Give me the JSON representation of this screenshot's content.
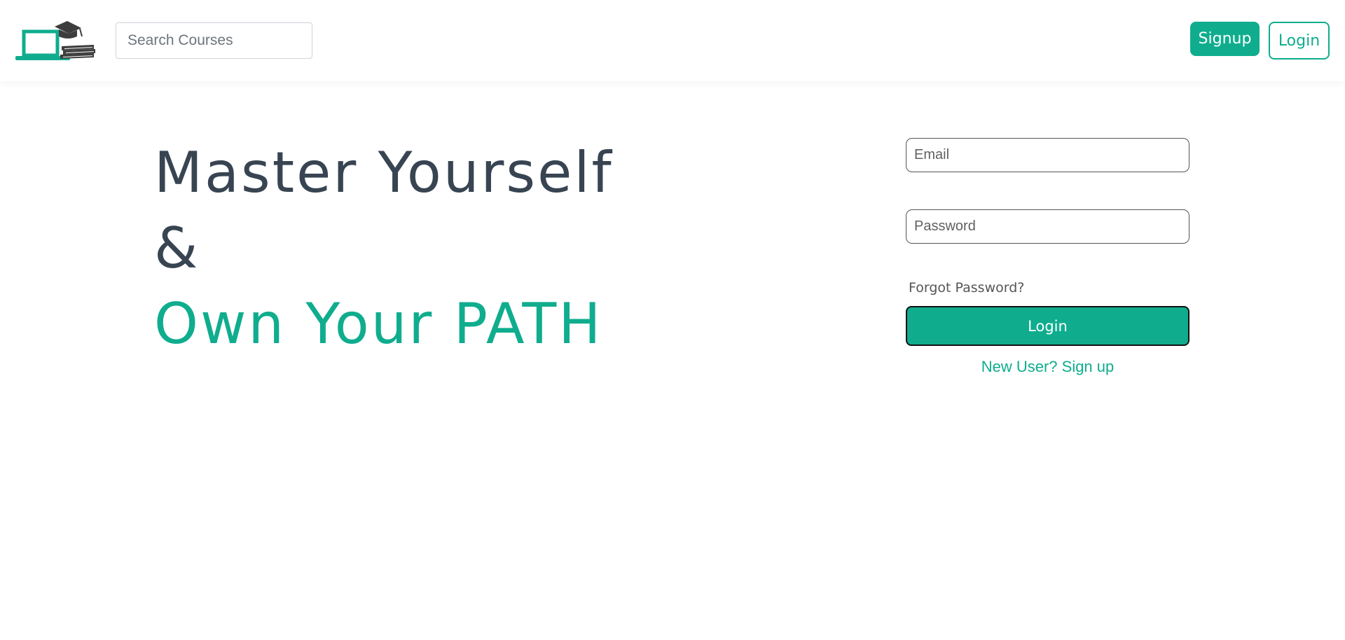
{
  "navbar": {
    "search": {
      "placeholder": "Search Courses",
      "value": ""
    },
    "signup_label": "Signup",
    "login_label": "Login"
  },
  "hero": {
    "line1": "Master Yourself",
    "line2": "&",
    "line3": "Own Your PATH"
  },
  "login_form": {
    "email": {
      "placeholder": "Email",
      "value": ""
    },
    "password": {
      "placeholder": "Password",
      "value": ""
    },
    "forgot_label": "Forgot Password?",
    "login_label": "Login",
    "new_user_label": "New User? Sign up"
  },
  "colors": {
    "accent": "#0fad8e",
    "heading": "#384452",
    "logo_dark": "#3d3d3d"
  },
  "icons": [
    "laptop-icon",
    "graduation-cap-icon",
    "books-icon"
  ]
}
